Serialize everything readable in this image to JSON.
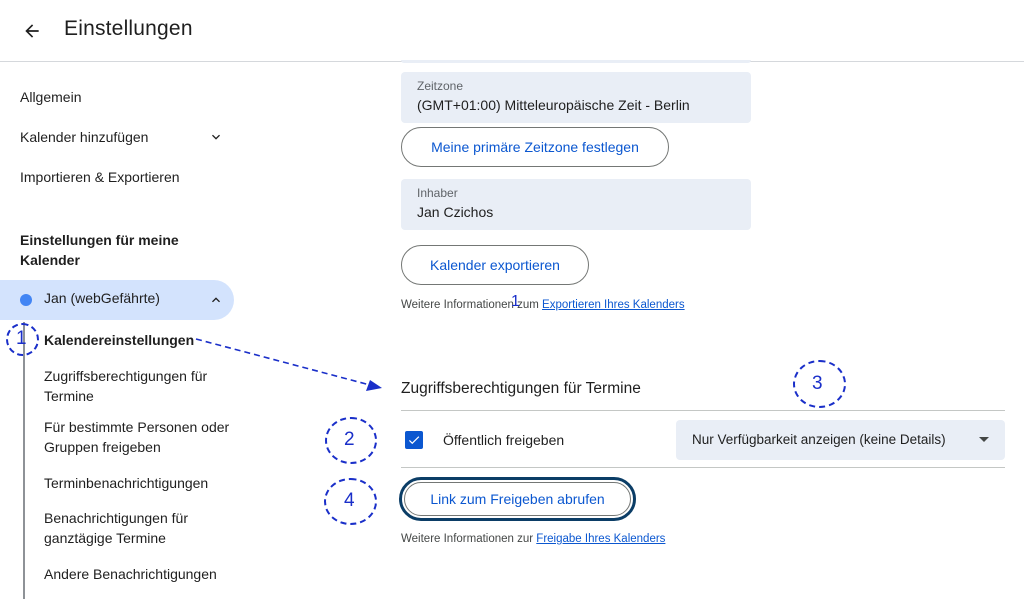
{
  "header": {
    "title": "Einstellungen"
  },
  "sidebar": {
    "items": [
      {
        "label": "Allgemein"
      },
      {
        "label": "Kalender hinzufügen"
      },
      {
        "label": "Importieren & Exportieren"
      }
    ],
    "section_title": "Einstellungen für meine Kalender",
    "calendar": {
      "name": "Jan (webGefährte)",
      "dot_color": "#4285f4"
    },
    "sub_items": [
      {
        "label": "Kalendereinstellungen"
      },
      {
        "label": "Zugriffsberechtigungen für Termine"
      },
      {
        "label": "Für bestimmte Personen oder Gruppen freigeben"
      },
      {
        "label": "Terminbenachrichtigungen"
      },
      {
        "label": "Benachrichtigungen für ganztägige Termine"
      },
      {
        "label": "Andere Benachrichtigungen"
      }
    ]
  },
  "main": {
    "timezone": {
      "label": "Zeitzone",
      "value": "(GMT+01:00) Mitteleuropäische Zeit - Berlin"
    },
    "primary_timezone_button": "Meine primäre Zeitzone festlegen",
    "owner": {
      "label": "Inhaber",
      "value": "Jan Czichos"
    },
    "export_button": "Kalender exportieren",
    "export_info": {
      "prefix": "Weitere Informationen zum ",
      "link": "Exportieren Ihres Kalenders"
    },
    "access_section": {
      "heading": "Zugriffsberechtigungen für Termine",
      "public_checkbox_label": "Öffentlich freigeben",
      "public_checked": true,
      "visibility_select": "Nur Verfügbarkeit anzeigen (keine Details)",
      "share_link_button": "Link zum Freigeben abrufen",
      "share_info": {
        "prefix": "Weitere Informationen zur ",
        "link": "Freigabe Ihres Kalenders"
      }
    }
  },
  "annotations": {
    "n1": "1",
    "n2": "2",
    "n3": "3",
    "n4": "4",
    "cursor_mark": "1"
  },
  "colors": {
    "accent": "#0b57d0",
    "annotation": "#1a2fc9",
    "selected_bg": "#d3e3fd"
  }
}
